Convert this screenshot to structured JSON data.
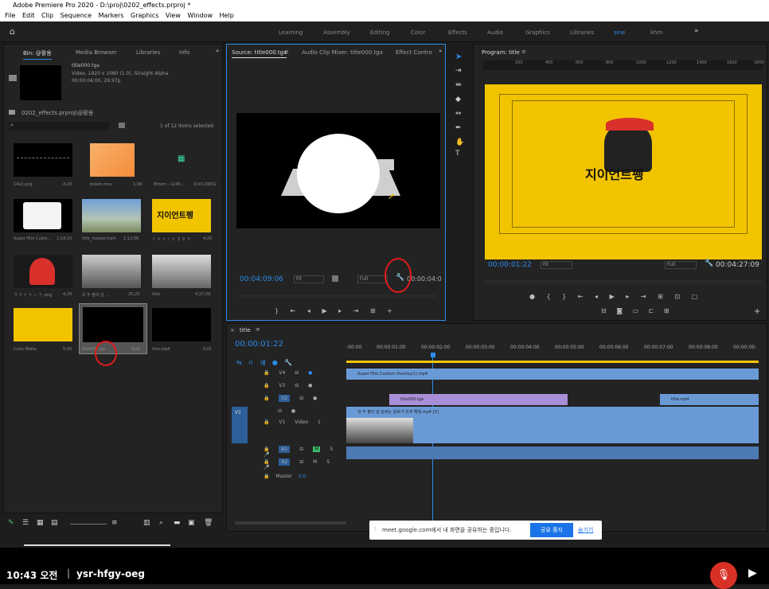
{
  "app": {
    "title": "Adobe Premiere Pro 2020 - D:\\proj\\0202_effects.prproj *",
    "logo": "Pr"
  },
  "menu": [
    "File",
    "Edit",
    "Clip",
    "Sequence",
    "Markers",
    "Graphics",
    "View",
    "Window",
    "Help"
  ],
  "workspaces": [
    "Learning",
    "Assembly",
    "Editing",
    "Color",
    "Effects",
    "Audio",
    "Graphics",
    "Libraries",
    "sine",
    "khm"
  ],
  "project": {
    "tabs": [
      "Bin: @활용",
      "Media Browser",
      "Libraries",
      "Info"
    ],
    "preview_name": "title000.tga",
    "preview_info1": "Video, 1920 x 1080 (1.0), Straight Alpha",
    "preview_info2": "00;00;04;00, 29.97p",
    "path": "0202_effects.prproj\\@활용",
    "count": "1 of 12 Items selected",
    "items": [
      {
        "name": "14x2.png",
        "dur": "4;29"
      },
      {
        "name": "bokeh.mov",
        "dur": "1;08"
      },
      {
        "name": "Ethem - 1245...",
        "dur": "3:03:29852"
      },
      {
        "name": "Super Film Custo...",
        "dur": "1;14;15"
      },
      {
        "name": "title_master.mp4",
        "dur": "1;12;06"
      },
      {
        "name": "ㅈ ㅂ ㅇ ㅣ ㅇ ㅔ ㄹ ㅋ",
        "dur": "4;29"
      },
      {
        "name": "ㅋ ㅋ ㅇ ㅇ ㅅ ㅋ .png",
        "dur": "4;29"
      },
      {
        "name": "내 두 팔이 널 ...",
        "dur": "25;20"
      },
      {
        "name": "title",
        "dur": "4;27;09"
      },
      {
        "name": "Color Matte",
        "dur": "5;00"
      },
      {
        "name": "title000.tga",
        "dur": "4;00"
      },
      {
        "name": "title.mp4",
        "dur": "5;01"
      }
    ]
  },
  "source": {
    "tabs": [
      "Source: title000.tga",
      "Audio Clip Mixer: title000.tga",
      "Effect Contro"
    ],
    "timecode": "00:04:09:06",
    "fit": "Fit",
    "quality": "Full",
    "duration": "00:00:04:0"
  },
  "program": {
    "tab": "Program: title",
    "timecode": "00:00:01:22",
    "fit": "Fit",
    "quality": "Full",
    "duration": "00:04:27:09",
    "logo_text": "지이언트펭",
    "ruler": [
      "200",
      "400",
      "600",
      "800",
      "1000",
      "1200",
      "1400",
      "1600",
      "1800"
    ]
  },
  "timeline": {
    "tab": "title",
    "timecode": "00:00:01:22",
    "ruler": [
      ":00:00",
      "00:00:01:00",
      "00:00:02:00",
      "00:00:03:00",
      "00:00:04:00",
      "00:00:05:00",
      "00:00:06:00",
      "00:00:07:00",
      "00:00:08:00",
      "00:00:09:"
    ],
    "tracks": {
      "v4": "V4",
      "v3": "V3",
      "v2": "V2",
      "v1": "V1",
      "video1": "Video 1",
      "a1": "A1",
      "a2": "A2",
      "master": "Master",
      "master_val": "0.0"
    },
    "clips": {
      "v4": "Super Film Custom Overlay(1).mp4",
      "v2a": "title000.tga",
      "v2b": "title.mp4",
      "v1": "내 두 팔이 널 감싸는 왕호가 되게 해줘.mp4 [V]"
    }
  },
  "meet": {
    "text": "meet.google.com에서 내 화면을 공유하는 중입니다.",
    "stop": "공유 중지",
    "hide": "숨기기"
  },
  "bottom": {
    "time": "10:43 오전",
    "code": "ysr-hfgy-oeg"
  },
  "colors": {
    "accent": "#2d8ceb",
    "v2clip": "#a98fd8",
    "v1clip": "#6a9ad6",
    "yellow": "#f2c400",
    "red": "#d93025"
  }
}
